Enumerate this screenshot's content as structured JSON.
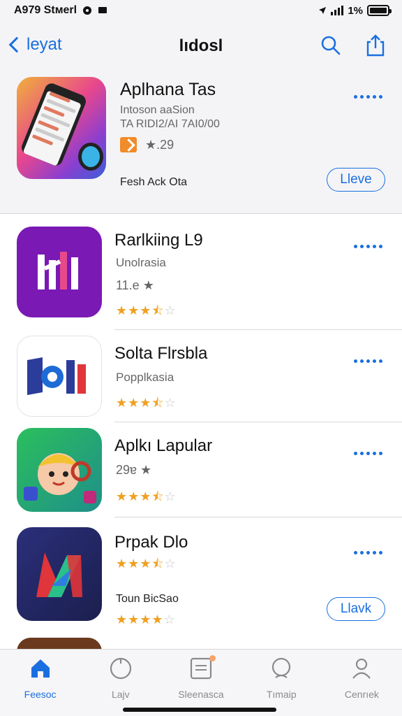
{
  "status_bar": {
    "carrier": "A979 Stмerl",
    "battery_text": "1%"
  },
  "nav": {
    "back_label": "leyat",
    "title": "lıdosl"
  },
  "featured": {
    "title": "Aplhana Tas",
    "subtitle_line1": "Intoson aaSion",
    "subtitle_line2": "TA RIDI2/AI 7AI0/00",
    "rating": "★.29",
    "caption": "Fesh Ack Ota",
    "button_label": "Lleve"
  },
  "apps": [
    {
      "title": "Rarlkiing L9",
      "subtitle": "Unolrasia",
      "rating": "11.e ★",
      "stars": 3.5
    },
    {
      "title": "Solta Flrsbla",
      "subtitle": "Popplkasia",
      "stars": 3.5
    },
    {
      "title": "Aplkı Lapular",
      "rating": "29ɐ ★",
      "stars": 3.5
    },
    {
      "title": "Prpak Dlo",
      "caption": "Toun BicSao",
      "stars": 3.5,
      "stars2": 4,
      "button_label": "Llavk"
    }
  ],
  "tabs": [
    {
      "label": "Feesoc",
      "icon": "home-icon",
      "active": true
    },
    {
      "label": "Lajv",
      "icon": "circle-icon"
    },
    {
      "label": "Sleenasca",
      "icon": "list-icon"
    },
    {
      "label": "Tımaip",
      "icon": "chat-icon"
    },
    {
      "label": "Cenrıek",
      "icon": "person-icon"
    }
  ],
  "colors": {
    "accent": "#1a6fe0",
    "star": "#f0a020",
    "nav_bg": "#f4f4f6"
  }
}
